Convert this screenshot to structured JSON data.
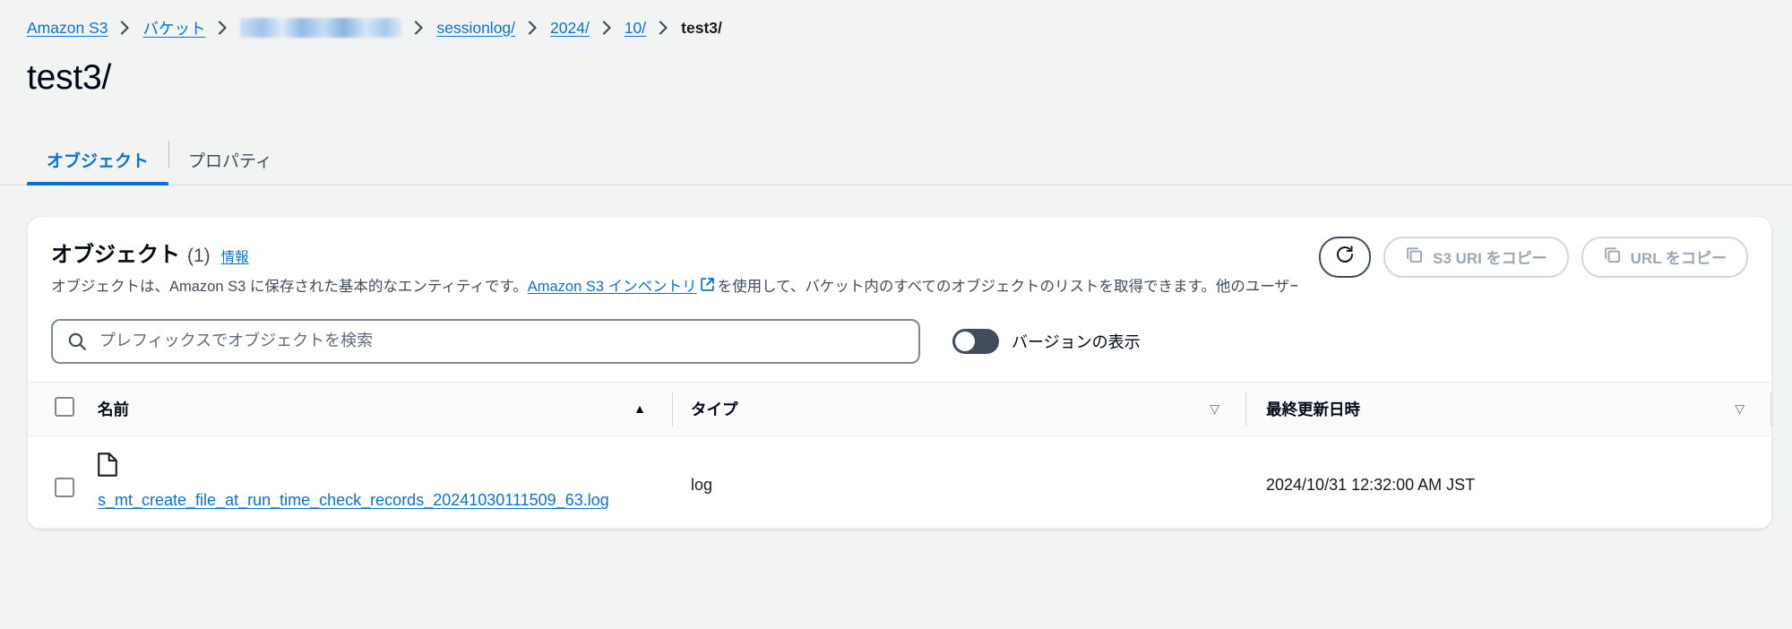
{
  "breadcrumb": {
    "items": [
      {
        "label": "Amazon S3",
        "type": "link"
      },
      {
        "label": "バケット",
        "type": "link"
      },
      {
        "label": "",
        "type": "redacted"
      },
      {
        "label": "sessionlog/",
        "type": "link"
      },
      {
        "label": "2024/",
        "type": "link"
      },
      {
        "label": "10/",
        "type": "link"
      },
      {
        "label": "test3/",
        "type": "current"
      }
    ],
    "separator": "chevron-right-icon"
  },
  "page": {
    "title": "test3/"
  },
  "tabs": [
    {
      "label": "オブジェクト",
      "active": true
    },
    {
      "label": "プロパティ",
      "active": false
    }
  ],
  "card": {
    "title": "オブジェクト",
    "count": "(1)",
    "info_link": "情報",
    "description_part1": "オブジェクトは、Amazon S3 に保存された基本的なエンティティです。",
    "description_link": "Amazon S3 インベントリ",
    "description_part2": "を使用して、バケット内のすべてのオブジェクトのリストを取得できます。他のユーザーが自分のオブジェクトにアクセスできるためには、明",
    "actions": {
      "refresh": {
        "label": "",
        "icon": "refresh-icon",
        "disabled": false
      },
      "copy_s3_uri": {
        "label": "S3 URI をコピー",
        "icon": "copy-icon",
        "disabled": true
      },
      "copy_url": {
        "label": "URL をコピー",
        "icon": "copy-icon",
        "disabled": true
      }
    }
  },
  "filter": {
    "search_placeholder": "プレフィックスでオブジェクトを検索",
    "search_value": "",
    "toggle_label": "バージョンの表示",
    "toggle_on": false
  },
  "table": {
    "columns": [
      {
        "key": "name",
        "label": "名前",
        "sort": "asc"
      },
      {
        "key": "type",
        "label": "タイプ",
        "sort": "none"
      },
      {
        "key": "last_modified",
        "label": "最終更新日時",
        "sort": "none"
      }
    ],
    "sort_asc_glyph": "▲",
    "sort_none_glyph": "▽",
    "rows": [
      {
        "name": "s_mt_create_file_at_run_time_check_records_20241030111509_63.log",
        "type": "log",
        "last_modified": "2024/10/31 12:32:00 AM JST",
        "icon": "file-icon",
        "selected": false
      }
    ]
  },
  "colors": {
    "link": "#0972d3",
    "text": "#16191f",
    "page_background": "#f2f3f3",
    "card_background": "#ffffff",
    "border": "#e9ebed",
    "toggle_off": "#414d5c"
  }
}
